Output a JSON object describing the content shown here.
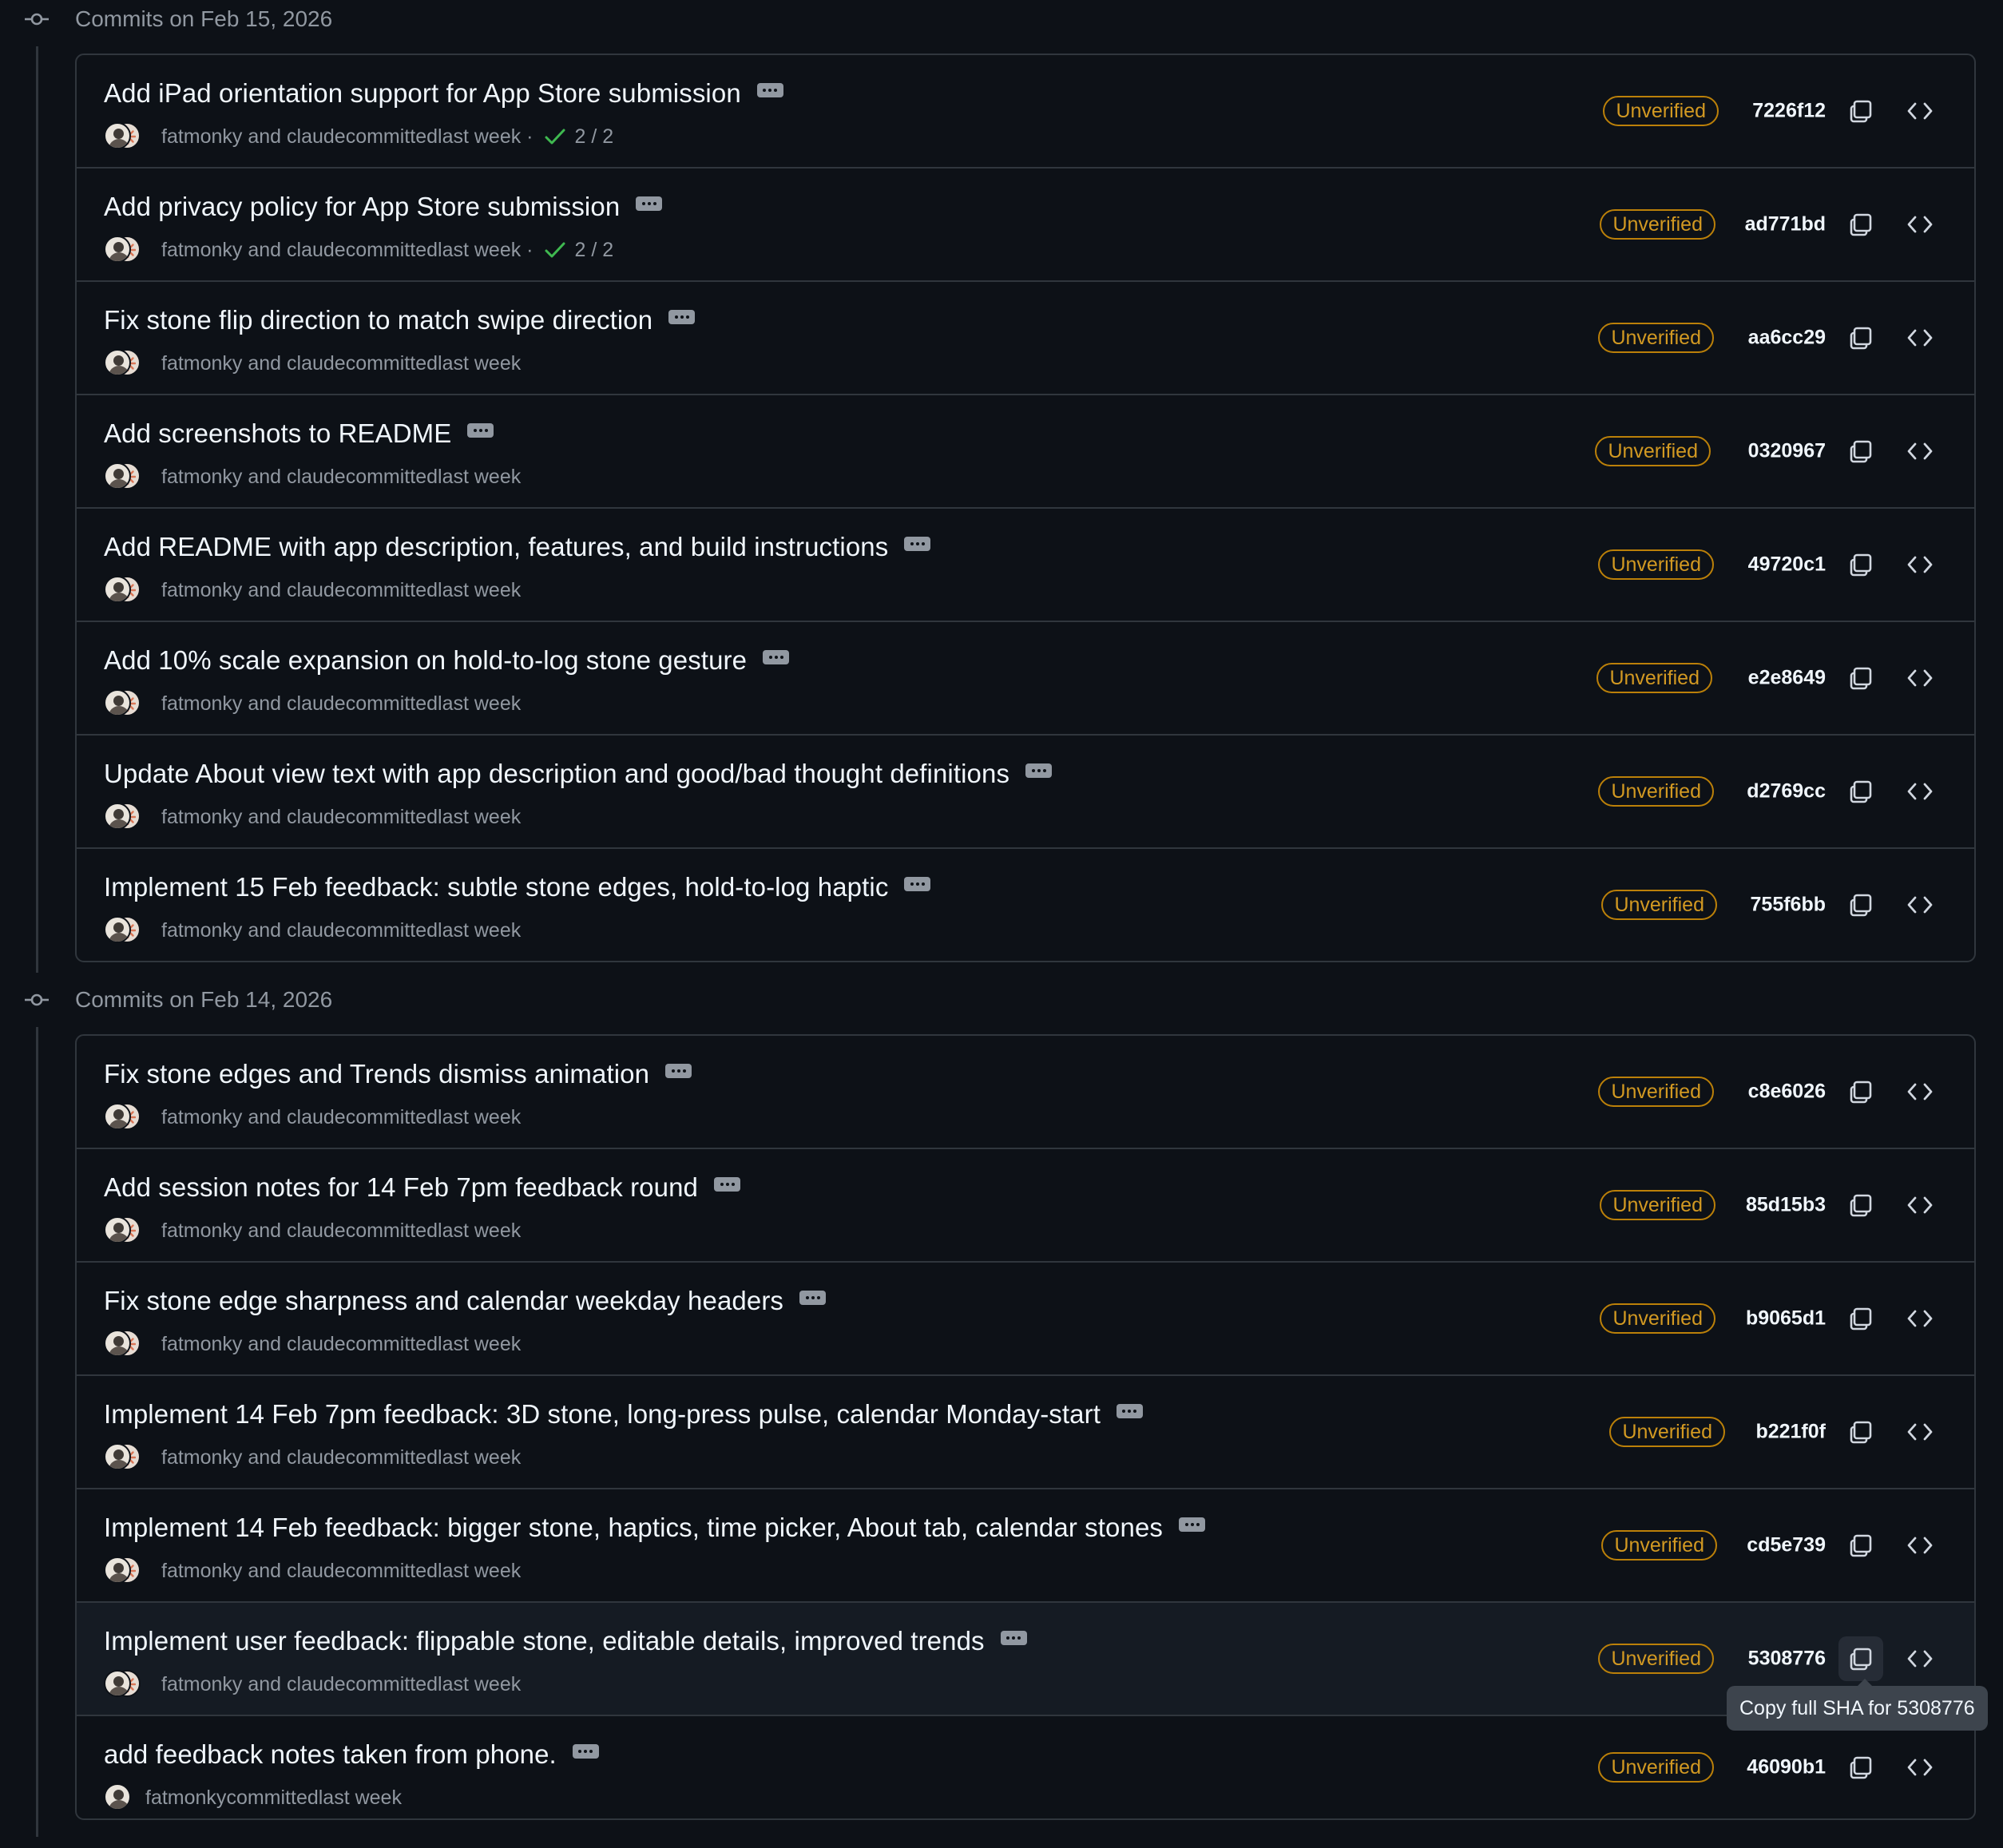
{
  "groups": [
    {
      "title": "Commits on Feb 15, 2026",
      "commits": [
        {
          "message": "Add iPad orientation support for App Store submission",
          "authors": "fatmonky and claude",
          "action": "committed",
          "time": "last week",
          "checks": "2 / 2",
          "badge": "Unverified",
          "sha": "7226f12"
        },
        {
          "message": "Add privacy policy for App Store submission",
          "authors": "fatmonky and claude",
          "action": "committed",
          "time": "last week",
          "checks": "2 / 2",
          "badge": "Unverified",
          "sha": "ad771bd"
        },
        {
          "message": "Fix stone flip direction to match swipe direction",
          "authors": "fatmonky and claude",
          "action": "committed",
          "time": "last week",
          "badge": "Unverified",
          "sha": "aa6cc29"
        },
        {
          "message": "Add screenshots to README",
          "authors": "fatmonky and claude",
          "action": "committed",
          "time": "last week",
          "badge": "Unverified",
          "sha": "0320967"
        },
        {
          "message": "Add README with app description, features, and build instructions",
          "authors": "fatmonky and claude",
          "action": "committed",
          "time": "last week",
          "badge": "Unverified",
          "sha": "49720c1"
        },
        {
          "message": "Add 10% scale expansion on hold-to-log stone gesture",
          "authors": "fatmonky and claude",
          "action": "committed",
          "time": "last week",
          "badge": "Unverified",
          "sha": "e2e8649"
        },
        {
          "message": "Update About view text with app description and good/bad thought definitions",
          "authors": "fatmonky and claude",
          "action": "committed",
          "time": "last week",
          "badge": "Unverified",
          "sha": "d2769cc"
        },
        {
          "message": "Implement 15 Feb feedback: subtle stone edges, hold-to-log haptic",
          "authors": "fatmonky and claude",
          "action": "committed",
          "time": "last week",
          "badge": "Unverified",
          "sha": "755f6bb"
        }
      ]
    },
    {
      "title": "Commits on Feb 14, 2026",
      "commits": [
        {
          "message": "Fix stone edges and Trends dismiss animation",
          "authors": "fatmonky and claude",
          "action": "committed",
          "time": "last week",
          "badge": "Unverified",
          "sha": "c8e6026"
        },
        {
          "message": "Add session notes for 14 Feb 7pm feedback round",
          "authors": "fatmonky and claude",
          "action": "committed",
          "time": "last week",
          "badge": "Unverified",
          "sha": "85d15b3"
        },
        {
          "message": "Fix stone edge sharpness and calendar weekday headers",
          "authors": "fatmonky and claude",
          "action": "committed",
          "time": "last week",
          "badge": "Unverified",
          "sha": "b9065d1"
        },
        {
          "message": "Implement 14 Feb 7pm feedback: 3D stone, long-press pulse, calendar Monday-start",
          "authors": "fatmonky and claude",
          "action": "committed",
          "time": "last week",
          "badge": "Unverified",
          "sha": "b221f0f"
        },
        {
          "message": "Implement 14 Feb feedback: bigger stone, haptics, time picker, About tab, calendar stones",
          "authors": "fatmonky and claude",
          "action": "committed",
          "time": "last week",
          "badge": "Unverified",
          "sha": "cd5e739"
        },
        {
          "message": "Implement user feedback: flippable stone, editable details, improved trends",
          "authors": "fatmonky and claude",
          "action": "committed",
          "time": "last week",
          "badge": "Unverified",
          "sha": "5308776"
        },
        {
          "message": "add feedback notes taken from phone.",
          "authors": "fatmonky",
          "action": "committed",
          "time": "last week",
          "badge": "Unverified",
          "sha": "46090b1"
        }
      ]
    }
  ],
  "tooltip": "Copy full SHA for 5308776",
  "icons": {
    "commit_node": "git-commit-icon",
    "ellipsis": "kebab-horizontal-icon",
    "check": "check-icon",
    "copy": "copy-icon",
    "browse": "code-icon"
  },
  "colors": {
    "background": "#0d1117",
    "border": "#30363d",
    "text_primary": "#f0f6fc",
    "text_muted": "#9198a1",
    "badge_unverified": "#d29922",
    "check_success": "#3fb950"
  }
}
